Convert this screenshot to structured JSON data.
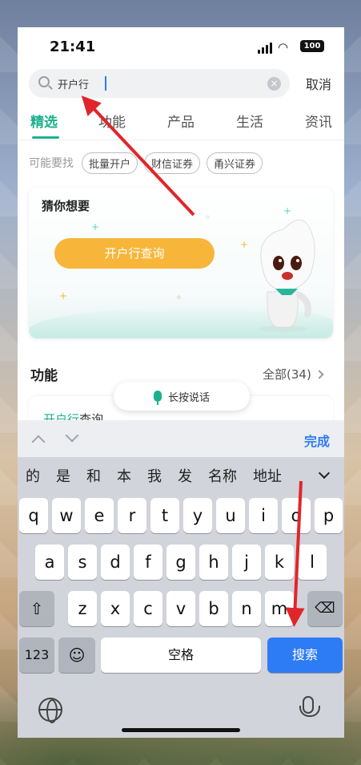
{
  "status_bar": {
    "time": "21:41",
    "battery": "100"
  },
  "search": {
    "value": "开户行",
    "cancel_label": "取消"
  },
  "tabs": [
    {
      "label": "精选",
      "active": true
    },
    {
      "label": "功能",
      "active": false
    },
    {
      "label": "产品",
      "active": false
    },
    {
      "label": "生活",
      "active": false
    },
    {
      "label": "资讯",
      "active": false
    }
  ],
  "suggest": {
    "label": "可能要找",
    "chips": [
      "批量开户",
      "财信证券",
      "甬兴证券"
    ]
  },
  "guess": {
    "title": "猜你想要",
    "button_label": "开户行查询"
  },
  "features": {
    "title": "功能",
    "all_label": "全部(34)",
    "item_highlight": "开户行",
    "item_rest": "查询"
  },
  "voice": {
    "label": "长按说话"
  },
  "keyboard": {
    "done_label": "完成",
    "candidates": [
      "的",
      "是",
      "和",
      "本",
      "我",
      "发",
      "名称",
      "地址"
    ],
    "row1": [
      "q",
      "w",
      "e",
      "r",
      "t",
      "y",
      "u",
      "i",
      "o",
      "p"
    ],
    "row2": [
      "a",
      "s",
      "d",
      "f",
      "g",
      "h",
      "j",
      "k",
      "l"
    ],
    "row3": [
      "z",
      "x",
      "c",
      "v",
      "b",
      "n",
      "m"
    ],
    "numbers_label": "123",
    "space_label": "空格",
    "search_label": "搜索"
  },
  "colors": {
    "accent": "#1bb18e",
    "button": "#f7b63a",
    "key_blue": "#2e7bf6",
    "arrow": "#e0262b"
  }
}
